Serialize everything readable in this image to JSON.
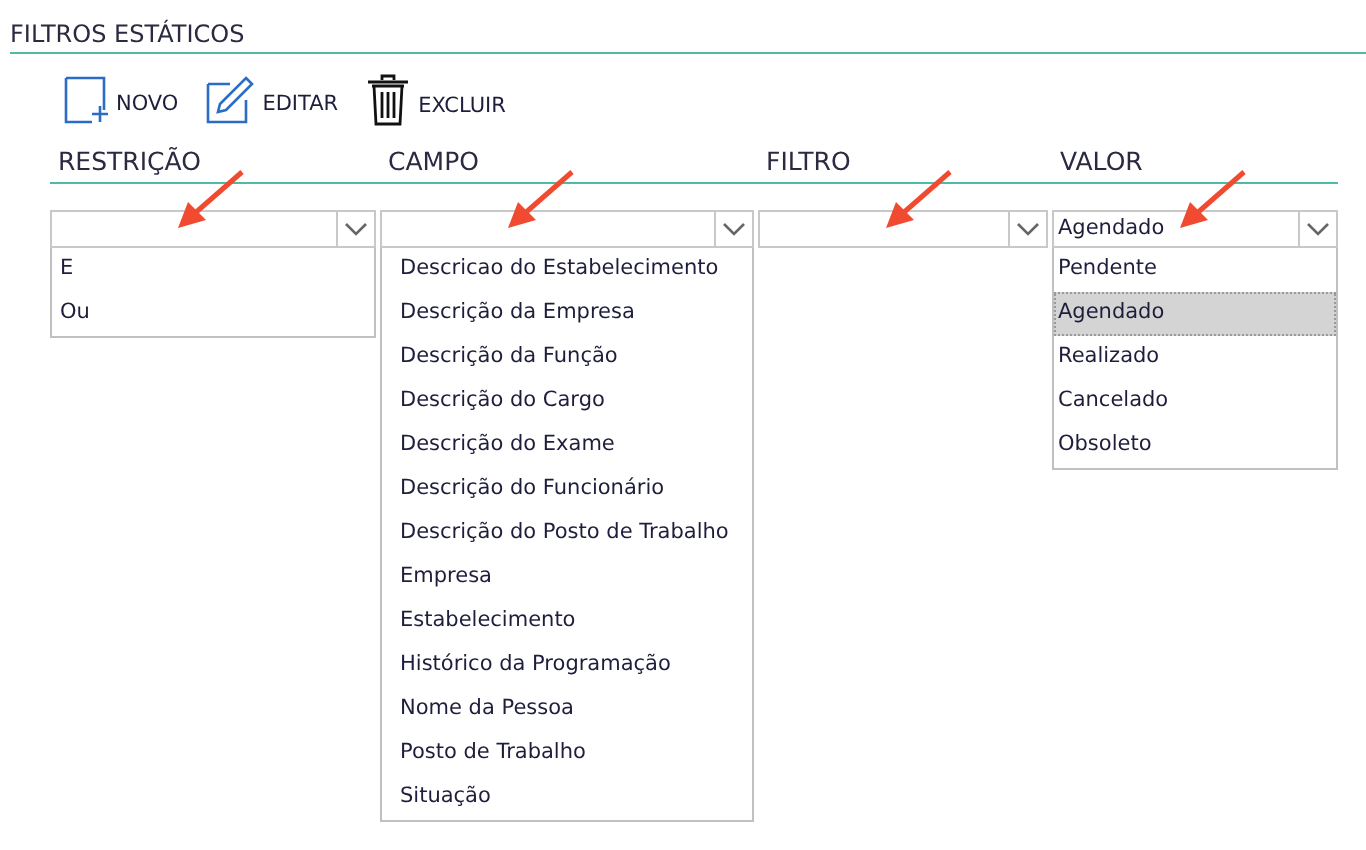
{
  "title": "FILTROS ESTÁTICOS",
  "toolbar": [
    {
      "kind": "new",
      "label": "NOVO"
    },
    {
      "kind": "edit",
      "label": "EDITAR"
    },
    {
      "kind": "delete",
      "label": "EXCLUIR"
    }
  ],
  "columns": [
    {
      "header": "RESTRIÇÃO",
      "annotated": true,
      "dropdown": {
        "options": [
          {
            "label": "E",
            "selected": false
          },
          {
            "label": "Ou",
            "selected": false
          }
        ]
      }
    },
    {
      "header": "CAMPO",
      "annotated": true,
      "dropdown": {
        "options": [
          {
            "label": "Descricao do Estabelecimento",
            "selected": false
          },
          {
            "label": "Descrição da Empresa",
            "selected": false
          },
          {
            "label": "Descrição da Função",
            "selected": false
          },
          {
            "label": "Descrição do Cargo",
            "selected": false
          },
          {
            "label": "Descrição do Exame",
            "selected": false
          },
          {
            "label": "Descrição do Funcionário",
            "selected": false
          },
          {
            "label": "Descrição do Posto de Trabalho",
            "selected": false
          },
          {
            "label": "Empresa",
            "selected": false
          },
          {
            "label": "Estabelecimento",
            "selected": false
          },
          {
            "label": "Histórico da Programação",
            "selected": false
          },
          {
            "label": "Nome da Pessoa",
            "selected": false
          },
          {
            "label": "Posto de Trabalho",
            "selected": false
          },
          {
            "label": "Situação",
            "selected": false
          }
        ]
      }
    },
    {
      "header": "FILTRO",
      "annotated": true
    },
    {
      "header": "VALOR",
      "annotated": true,
      "dropdown": {
        "value": "Agendado",
        "options": [
          {
            "label": "Pendente",
            "selected": false
          },
          {
            "label": "Agendado",
            "selected": true
          },
          {
            "label": "Realizado",
            "selected": false
          },
          {
            "label": "Cancelado",
            "selected": false
          },
          {
            "label": "Obsoleto",
            "selected": false
          }
        ]
      }
    }
  ]
}
